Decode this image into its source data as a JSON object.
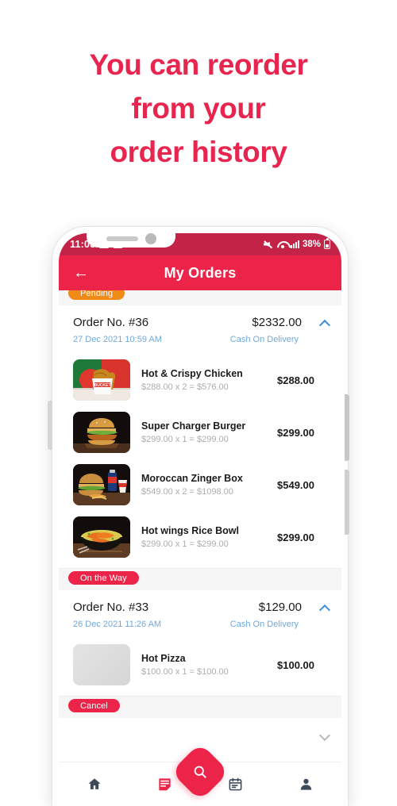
{
  "headline": {
    "lines": [
      "You can reorder",
      "from your",
      "order history"
    ],
    "color": "#E8254E"
  },
  "statusbar": {
    "time": "11:03",
    "battery_percent": "38%",
    "icons": [
      "gallery-icon",
      "youtube-icon",
      "mute-icon",
      "wifi-icon",
      "signal-icon",
      "battery-icon"
    ],
    "background": "#C42348"
  },
  "appbar": {
    "title": "My Orders",
    "back_label": "←",
    "background": "#ED2449"
  },
  "orders": [
    {
      "status": "Pending",
      "status_color": "#F08A18",
      "number": "Order No. #36",
      "total": "$2332.00",
      "date": "27 Dec 2021 10:59 AM",
      "payment": "Cash On Delivery",
      "expanded": true,
      "items": [
        {
          "name": "Hot & Crispy Chicken",
          "calc": "$288.00 x 2 = $576.00",
          "price": "$288.00",
          "image": "fried-chicken-bucket"
        },
        {
          "name": "Super Charger Burger",
          "calc": "$299.00 x 1 = $299.00",
          "price": "$299.00",
          "image": "chicken-burger"
        },
        {
          "name": "Moroccan Zinger Box",
          "calc": "$549.00 x 2 = $1098.00",
          "price": "$549.00",
          "image": "zinger-box-meal"
        },
        {
          "name": "Hot wings Rice Bowl",
          "calc": "$299.00 x 1 = $299.00",
          "price": "$299.00",
          "image": "rice-bowl"
        }
      ]
    },
    {
      "status": "On the Way",
      "status_color": "#ED2449",
      "number": "Order No. #33",
      "total": "$129.00",
      "date": "26 Dec 2021 11:26 AM",
      "payment": "Cash On Delivery",
      "expanded": true,
      "items": [
        {
          "name": "Hot Pizza",
          "calc": "$100.00 x 1 = $100.00",
          "price": "$100.00",
          "image": "placeholder"
        }
      ]
    },
    {
      "status": "Cancel",
      "status_color": "#ED2449",
      "number": "",
      "total": "",
      "date": "",
      "payment": "",
      "expanded": false,
      "items": []
    }
  ],
  "bottomnav": {
    "items": [
      {
        "icon": "home-icon",
        "active": false
      },
      {
        "icon": "orders-note-icon",
        "active": true
      },
      {
        "icon": "calendar-icon",
        "active": false
      },
      {
        "icon": "profile-icon",
        "active": false
      }
    ],
    "fab_icon": "search-icon",
    "active_color": "#ED2449",
    "inactive_color": "#3C4A5A"
  }
}
